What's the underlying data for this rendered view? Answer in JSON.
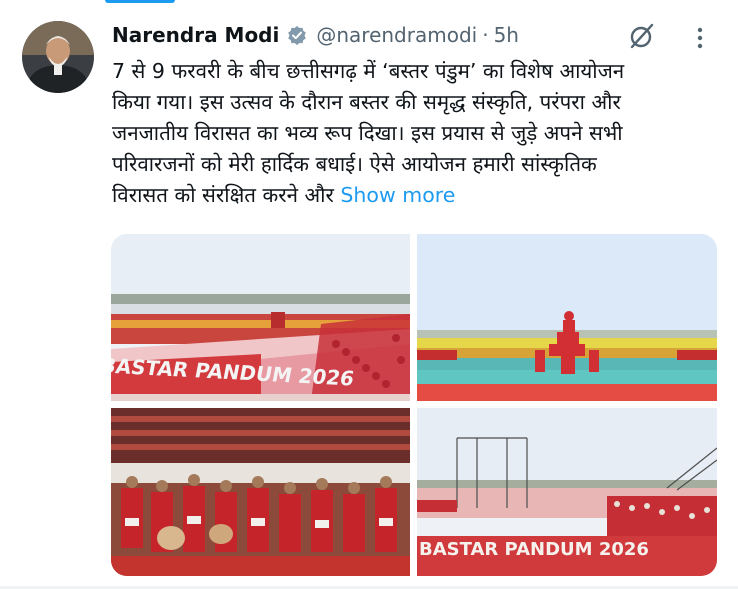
{
  "tweet": {
    "author_name": "Narendra Modi",
    "handle": "@narendramodi",
    "separator": "·",
    "time": "5h",
    "text_lines": [
      "7 से 9 फरवरी के बीच छत्तीसगढ़ में ‘बस्तर पंडुम’ का विशेष आयोजन",
      "किया गया। इस उत्सव के दौरान बस्तर की समृद्ध संस्कृति, परंपरा और",
      "जनजातीय विरासत का भव्य रूप दिखा। इस प्रयास से जुड़े अपने सभी",
      "परिवारजनों को मेरी हार्दिक बधाई। ऐसे आयोजन हमारी सांस्कृतिक",
      "विरासत को संरक्षित करने और"
    ],
    "show_more": "Show more"
  },
  "media": {
    "banner_top_left": "BASTAR PANDUM 2026",
    "banner_bottom_right": "BASTAR PANDUM 2026"
  },
  "colors": {
    "accent": "#1d9bf0",
    "secondary_text": "#536471",
    "verified_badge": "#829aab"
  },
  "icons": [
    "verified-badge-icon",
    "grok-icon",
    "more-options-icon"
  ]
}
